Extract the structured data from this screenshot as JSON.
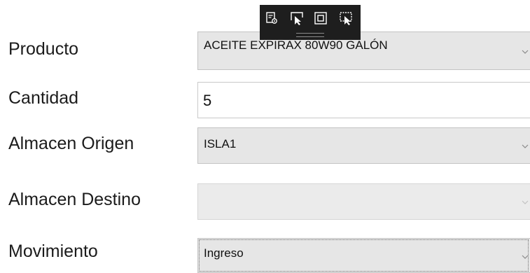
{
  "form": {
    "fields": [
      {
        "label": "Producto",
        "value": "ACEITE EXPIRAX 80W90 GALÓN"
      },
      {
        "label": "Cantidad",
        "value": "5"
      },
      {
        "label": "Almacen Origen",
        "value": "ISLA1"
      },
      {
        "label": "Almacen Destino",
        "value": ""
      },
      {
        "label": "Movimiento",
        "value": "Ingreso"
      }
    ]
  },
  "debug_toolbar": {
    "buttons": [
      "live-visual-tree-icon",
      "select-element-icon",
      "display-layout-adorners-icon",
      "track-focus-icon"
    ]
  },
  "colors": {
    "combo_background": "#e6e6e6",
    "toolbar_background": "#1e1e1e",
    "text": "#1b1b1b"
  }
}
